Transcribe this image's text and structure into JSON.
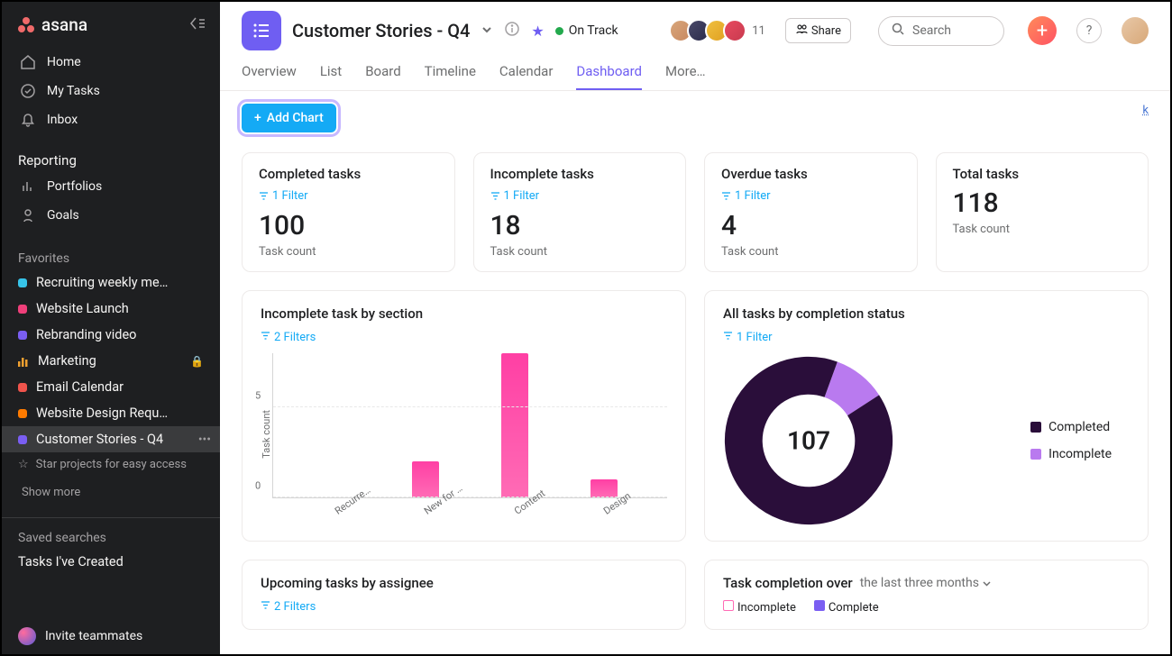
{
  "brand": "asana",
  "sidebar": {
    "nav": [
      {
        "label": "Home"
      },
      {
        "label": "My Tasks"
      },
      {
        "label": "Inbox"
      }
    ],
    "reporting_label": "Reporting",
    "reporting": [
      {
        "label": "Portfolios"
      },
      {
        "label": "Goals"
      }
    ],
    "favorites_label": "Favorites",
    "favorites": [
      {
        "label": "Recruiting weekly me…",
        "color": "#37c4e9"
      },
      {
        "label": "Website Launch",
        "color": "#ef3f7a"
      },
      {
        "label": "Rebranding video",
        "color": "#7a5ef2"
      },
      {
        "label": "Marketing",
        "color": "",
        "type": "bars",
        "locked": true
      },
      {
        "label": "Email Calendar",
        "color": "#f0544c"
      },
      {
        "label": "Website Design Requ…",
        "color": "#ff7b00"
      },
      {
        "label": "Customer Stories - Q4",
        "color": "#7a5ef2",
        "active": true
      }
    ],
    "star_hint": "Star projects for easy access",
    "show_more": "Show more",
    "saved_searches_label": "Saved searches",
    "saved_searches": [
      {
        "label": "Tasks I've Created"
      }
    ],
    "invite": "Invite teammates"
  },
  "header": {
    "project_title": "Customer Stories - Q4",
    "status": "On Track",
    "avatar_count": "11",
    "share_label": "Share",
    "search_placeholder": "Search",
    "tabs": [
      "Overview",
      "List",
      "Board",
      "Timeline",
      "Calendar",
      "Dashboard",
      "More…"
    ],
    "active_tab": "Dashboard"
  },
  "toolbar": {
    "add_chart": "Add Chart",
    "feedback": "k"
  },
  "stats": [
    {
      "title": "Completed tasks",
      "filter": "1 Filter",
      "value": "100",
      "sub": "Task count"
    },
    {
      "title": "Incomplete tasks",
      "filter": "1 Filter",
      "value": "18",
      "sub": "Task count"
    },
    {
      "title": "Overdue tasks",
      "filter": "1 Filter",
      "value": "4",
      "sub": "Task count"
    },
    {
      "title": "Total tasks",
      "value": "118",
      "sub": "Task count"
    }
  ],
  "charts": {
    "bar": {
      "title": "Incomplete task by section",
      "filter": "2 Filters",
      "yaxis": "Task count"
    },
    "donut": {
      "title": "All tasks by completion status",
      "filter": "1 Filter",
      "center": "107",
      "legend": [
        {
          "label": "Completed",
          "color": "#2a0e3a"
        },
        {
          "label": "Incomplete",
          "color": "#b97aef"
        }
      ]
    },
    "upcoming": {
      "title": "Upcoming tasks by assignee",
      "filter": "2 Filters"
    },
    "completion": {
      "title_prefix": "Task completion over",
      "range": "the last three months",
      "legend": [
        {
          "label": "Incomplete",
          "color": "transparent",
          "border": "#ff6bb5"
        },
        {
          "label": "Complete",
          "color": "#7a5ef2"
        }
      ]
    }
  },
  "chart_data": [
    {
      "type": "bar",
      "title": "Incomplete task by section",
      "ylabel": "Task count",
      "ylim": [
        0,
        8
      ],
      "y_ticks": [
        0,
        5
      ],
      "categories": [
        "Recurre…",
        "New for …",
        "Content",
        "Design"
      ],
      "values": [
        0,
        2,
        8,
        1
      ]
    },
    {
      "type": "pie",
      "title": "All tasks by completion status",
      "total_label": "107",
      "series": [
        {
          "name": "Completed",
          "value": 96,
          "color": "#2a0e3a"
        },
        {
          "name": "Incomplete",
          "value": 11,
          "color": "#b97aef"
        }
      ]
    }
  ]
}
